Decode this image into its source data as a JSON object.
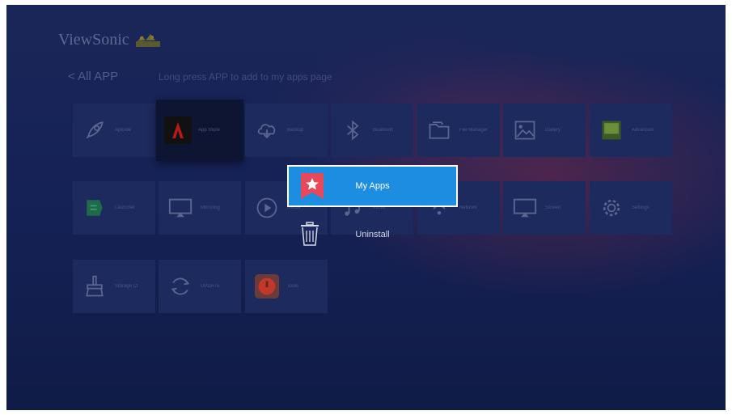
{
  "brand": {
    "name": "ViewSonic"
  },
  "header": {
    "back_label": "< All APP",
    "hint": "Long press APP to add to my apps page"
  },
  "apps": [
    {
      "label": "Aptoide",
      "icon": "rocket-icon"
    },
    {
      "label": "App Store",
      "icon": "app-store-icon"
    },
    {
      "label": "Backup",
      "icon": "cloud-download-icon"
    },
    {
      "label": "Bluetooth",
      "icon": "bluetooth-icon"
    },
    {
      "label": "File Manager",
      "icon": "folder-icon"
    },
    {
      "label": "Gallery",
      "icon": "image-icon"
    },
    {
      "label": "Advanced",
      "icon": "green-square-icon"
    },
    {
      "label": "Launcher",
      "icon": "launcher-icon"
    },
    {
      "label": "Mirroring",
      "icon": "cast-screen-icon"
    },
    {
      "label": "Media",
      "icon": "play-icon"
    },
    {
      "label": "Music",
      "icon": "music-icon"
    },
    {
      "label": "Network",
      "icon": "wifi-icon"
    },
    {
      "label": "Screen",
      "icon": "cast-screen-icon"
    },
    {
      "label": "Settings",
      "icon": "gear-icon"
    },
    {
      "label": "Storage Cl",
      "icon": "broom-icon"
    },
    {
      "label": "UPDATE",
      "icon": "refresh-icon"
    },
    {
      "label": "Tools",
      "icon": "power-red-icon"
    }
  ],
  "context_menu": {
    "items": [
      {
        "label": "My Apps",
        "icon": "bookmark-star-icon",
        "selected": true
      },
      {
        "label": "Uninstall",
        "icon": "trash-icon",
        "selected": false
      }
    ]
  },
  "colors": {
    "menu_highlight": "#1d8de1",
    "bookmark_red": "#e8495a",
    "background": "#152256"
  }
}
